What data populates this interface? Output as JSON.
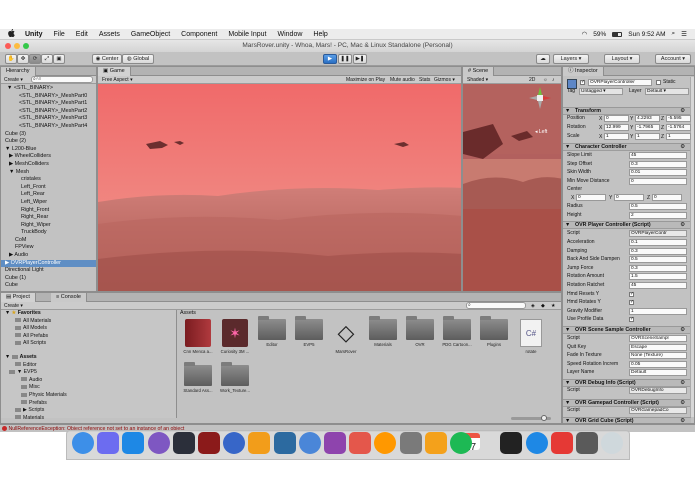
{
  "menubar": {
    "apple": "",
    "items": [
      "Unity",
      "File",
      "Edit",
      "Assets",
      "GameObject",
      "Component",
      "Mobile Input",
      "Window",
      "Help"
    ],
    "battery": "59%",
    "clock": "Sun 9:52 AM"
  },
  "titlebar": {
    "title": "MarsRover.unity - Whoa, Mars! - PC, Mac & Linux Standalone (Personal)"
  },
  "toolbar": {
    "pivot_label": "Center",
    "space_label": "Global",
    "account_label": "Account",
    "layers_label": "Layers",
    "layout_label": "Layout"
  },
  "hierarchy": {
    "tab": "Hierarchy",
    "create": "Create",
    "search_placeholder": "All",
    "rows": [
      {
        "label": "▼ <STL_BINARY>",
        "indent": 6
      },
      {
        "label": "<STL_BINARY>_MeshPart0",
        "indent": 18
      },
      {
        "label": "<STL_BINARY>_MeshPart1",
        "indent": 18
      },
      {
        "label": "<STL_BINARY>_MeshPart2",
        "indent": 18
      },
      {
        "label": "<STL_BINARY>_MeshPart3",
        "indent": 18
      },
      {
        "label": "<STL_BINARY>_MeshPart4",
        "indent": 18
      },
      {
        "label": "Cube (3)",
        "indent": 4
      },
      {
        "label": "Cube (2)",
        "indent": 4
      },
      {
        "label": "▼ L200-Blue",
        "indent": 4
      },
      {
        "label": "▶ WheelColliders",
        "indent": 8
      },
      {
        "label": "▶ MeshColliders",
        "indent": 8
      },
      {
        "label": "▼ Mesh",
        "indent": 8
      },
      {
        "label": "cristales",
        "indent": 20
      },
      {
        "label": "Left_Front",
        "indent": 20
      },
      {
        "label": "Left_Rear",
        "indent": 20
      },
      {
        "label": "Left_Wiper",
        "indent": 20
      },
      {
        "label": "Right_Front",
        "indent": 20
      },
      {
        "label": "Right_Rear",
        "indent": 20
      },
      {
        "label": "Right_Wiper",
        "indent": 20
      },
      {
        "label": "TruckBody",
        "indent": 20
      },
      {
        "label": "CoM",
        "indent": 14
      },
      {
        "label": "FPView",
        "indent": 14
      },
      {
        "label": "▶ Audio",
        "indent": 8
      },
      {
        "label": "▶ OVRPlayerController",
        "indent": 4,
        "selected": true
      },
      {
        "label": "Directional Light",
        "indent": 4
      },
      {
        "label": "Cube (1)",
        "indent": 4
      },
      {
        "label": "Cube",
        "indent": 4
      }
    ]
  },
  "game": {
    "tab": "Game",
    "aspect": "Free Aspect",
    "toggles": [
      "Maximize on Play",
      "Mute audio",
      "Stats",
      "Gizmos"
    ]
  },
  "scene": {
    "tab": "Scene",
    "shading": "Shaded",
    "mode_2d": "2D",
    "view_label": "Left"
  },
  "project": {
    "tabs": [
      "Project",
      "Console"
    ],
    "create": "Create",
    "breadcrumb": "Assets",
    "favorites_label": "Favorites",
    "favorites": [
      "All Materials",
      "All Models",
      "All Prefabs",
      "All Scripts"
    ],
    "assets_label": "Assets",
    "tree": [
      {
        "label": "Editor",
        "indent": 14
      },
      {
        "label": "▼ EVP5",
        "indent": 8
      },
      {
        "label": "Audio",
        "indent": 20
      },
      {
        "label": "Misc",
        "indent": 20
      },
      {
        "label": "Physic Materials",
        "indent": 20
      },
      {
        "label": "Prefabs",
        "indent": 20
      },
      {
        "label": "▶ Scripts",
        "indent": 14
      },
      {
        "label": "Materials",
        "indent": 14
      }
    ],
    "assets": [
      {
        "label": "Cnn Menca a...",
        "kind": "book"
      },
      {
        "label": "Curiosity 3M ...",
        "kind": "rover"
      },
      {
        "label": "Editor",
        "kind": "folder"
      },
      {
        "label": "EVP5",
        "kind": "folder"
      },
      {
        "label": "MarsRover",
        "kind": "unity"
      },
      {
        "label": "Materials",
        "kind": "folder"
      },
      {
        "label": "OVR",
        "kind": "folder"
      },
      {
        "label": "PDG Cartoon...",
        "kind": "folder"
      },
      {
        "label": "Plugins",
        "kind": "folder"
      },
      {
        "label": "rotate",
        "kind": "cs"
      },
      {
        "label": "Standard Ass...",
        "kind": "folder"
      },
      {
        "label": "Work_Texture...",
        "kind": "folder"
      }
    ]
  },
  "console_error": "NullReferenceException: Object reference not set to an instance of an object",
  "inspector": {
    "tab": "Inspector",
    "object_name": "OVRPlayerController",
    "static_label": "Static",
    "tag_label": "Tag",
    "tag_value": "Untagged",
    "layer_label": "Layer",
    "layer_value": "Default",
    "transform": {
      "title": "Transform",
      "position_label": "Position",
      "rotation_label": "Rotation",
      "scale_label": "Scale",
      "position": [
        "0",
        "4.2293",
        "-5.595"
      ],
      "rotation": [
        "12.999",
        "-1.7965",
        "-1.5764"
      ],
      "scale": [
        "1",
        "1",
        "1"
      ]
    },
    "character_controller": {
      "title": "Character Controller",
      "rows": [
        {
          "label": "Slope Limit",
          "value": "45"
        },
        {
          "label": "Step Offset",
          "value": "0.3"
        },
        {
          "label": "Skin Width",
          "value": "0.01"
        },
        {
          "label": "Min Move Distance",
          "value": "0"
        }
      ],
      "center_label": "Center",
      "center": [
        "0",
        "0",
        "0"
      ],
      "radius_label": "Radius",
      "radius": "0.5",
      "height_label": "Height",
      "height": "2"
    },
    "ovr_player": {
      "title": "OVR Player Controller (Script)",
      "script_label": "Script",
      "script_value": "OVRPlayerContr",
      "rows": [
        {
          "label": "Acceleration",
          "value": "0.1"
        },
        {
          "label": "Damping",
          "value": "0.3"
        },
        {
          "label": "Back And Side Dampen",
          "value": "0.5"
        },
        {
          "label": "Jump Force",
          "value": "0.3"
        },
        {
          "label": "Rotation Amount",
          "value": "1.5"
        },
        {
          "label": "Rotation Ratchet",
          "value": "45"
        }
      ],
      "checks": [
        {
          "label": "Hmd Resets Y",
          "on": true
        },
        {
          "label": "Hmd Rotates Y",
          "on": true
        }
      ],
      "gravity_label": "Gravity Modifier",
      "gravity_value": "1",
      "profile_label": "Use Profile Data",
      "profile_on": true
    },
    "ovr_scene_sample": {
      "title": "OVR Scene Sample Controller",
      "rows": [
        {
          "label": "Script",
          "value": "OVRSceneSampl"
        },
        {
          "label": "Quit Key",
          "value": "Escape"
        },
        {
          "label": "Fade In Texture",
          "value": "None (Texture)"
        },
        {
          "label": "Speed Rotation Increm",
          "value": "0.05"
        },
        {
          "label": "Layer Name",
          "value": "Default"
        }
      ]
    },
    "ovr_debug": {
      "title": "OVR Debug Info (Script)",
      "script_label": "Script",
      "script_value": "OVRDebugInfo"
    },
    "ovr_gamepad": {
      "title": "OVR Gamepad Controller (Script)",
      "script_label": "Script",
      "script_value": "OVRGamepadCo"
    },
    "ovr_grid": {
      "title": "OVR Grid Cube (Script)"
    }
  },
  "dock": {
    "calendar_day": "17",
    "icons": [
      "finder-icon",
      "siri-icon",
      "safari-icon",
      "launchpad-icon",
      "lightroom-icon",
      "cross-icon",
      "onepassword-icon",
      "sublime-icon",
      "sourcetree-icon",
      "folder-icon",
      "tasks-icon",
      "fantastical-icon",
      "lasso-icon",
      "preferences-icon",
      "keynote-icon",
      "spotify-icon",
      "calendar-icon",
      "unity-icon",
      "appstore-icon",
      "chrome-icon",
      "remote-icon",
      "trash-icon"
    ]
  },
  "colors": {
    "accent": "#3f7fd2",
    "selection": "#5f8ec4",
    "error": "#c62828"
  }
}
